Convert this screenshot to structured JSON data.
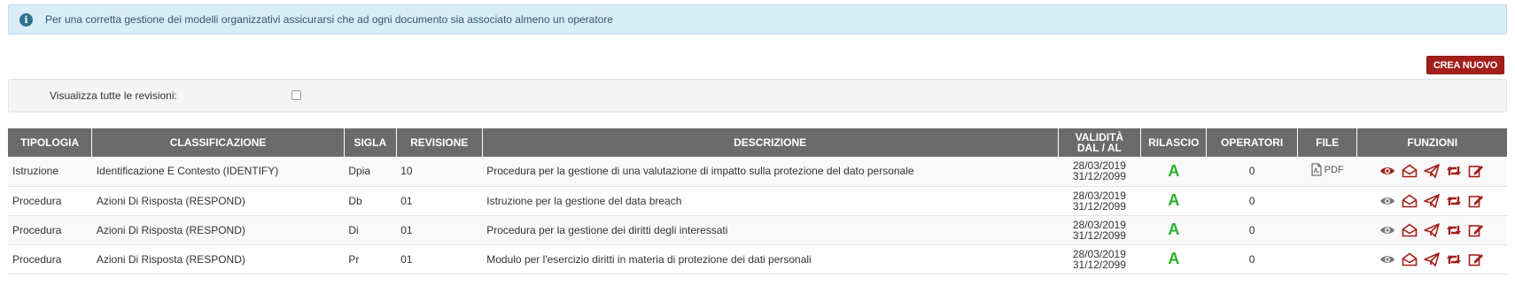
{
  "alert": {
    "icon": "info-circle-icon",
    "text": "Per una corretta gestione dei modelli organizzativi assicurarsi che ad ogni documento sia associato almeno un operatore"
  },
  "toolbar": {
    "create_label": "CREA NUOVO"
  },
  "filter": {
    "show_all_label": "Visualizza tutte le revisioni:",
    "show_all_checked": false
  },
  "table": {
    "headers": {
      "tipologia": "TIPOLOGIA",
      "classificazione": "CLASSIFICAZIONE",
      "sigla": "SIGLA",
      "revisione": "REVISIONE",
      "descrizione": "DESCRIZIONE",
      "validita_1": "VALIDITÀ",
      "validita_2": "DAL / AL",
      "rilascio": "RILASCIO",
      "operatori": "OPERATORI",
      "file": "FILE",
      "funzioni": "FUNZIONI"
    },
    "rows": [
      {
        "tipologia": "Istruzione",
        "classificazione": "Identificazione E Contesto (IDENTIFY)",
        "sigla": "Dpia",
        "revisione": "10",
        "descrizione": "Procedura per la gestione di una valutazione di impatto sulla protezione del dato personale",
        "dal": "28/03/2019",
        "al": "31/12/2099",
        "rilascio": "A",
        "operatori": "0",
        "file": "PDF",
        "view_active": true
      },
      {
        "tipologia": "Procedura",
        "classificazione": "Azioni Di Risposta (RESPOND)",
        "sigla": "Db",
        "revisione": "01",
        "descrizione": "Istruzione per la gestione del data breach",
        "dal": "28/03/2019",
        "al": "31/12/2099",
        "rilascio": "A",
        "operatori": "0",
        "file": "",
        "view_active": false
      },
      {
        "tipologia": "Procedura",
        "classificazione": "Azioni Di Risposta (RESPOND)",
        "sigla": "Di",
        "revisione": "01",
        "descrizione": "Procedura per la gestione dei diritti degli interessati",
        "dal": "28/03/2019",
        "al": "31/12/2099",
        "rilascio": "A",
        "operatori": "0",
        "file": "",
        "view_active": false
      },
      {
        "tipologia": "Procedura",
        "classificazione": "Azioni Di Risposta (RESPOND)",
        "sigla": "Pr",
        "revisione": "01",
        "descrizione": "Modulo per l'esercizio diritti in materia di protezione dei dati personali",
        "dal": "28/03/2019",
        "al": "31/12/2099",
        "rilascio": "A",
        "operatori": "0",
        "file": "",
        "view_active": false
      }
    ],
    "function_icons": [
      "eye-icon",
      "envelope-open-icon",
      "paper-plane-icon",
      "retweet-icon",
      "edit-icon"
    ]
  },
  "colors": {
    "accent_red": "#a31f1a",
    "header_gray": "#6b6b6b",
    "release_green": "#27b22a",
    "alert_bg": "#d9edf7",
    "icon_gray": "#666666"
  }
}
